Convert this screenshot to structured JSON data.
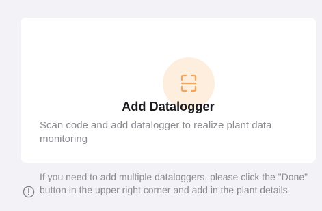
{
  "add_card": {
    "title": "Add Datalogger",
    "description": "Scan code and add datalogger to realize plant data monitoring",
    "icon": "scan-icon",
    "accent_color": "#f5a55b",
    "icon_bg_color": "#fdeede"
  },
  "hint": {
    "icon": "info-circle-icon",
    "text": "If you need to add multiple dataloggers, please click the \"Done\" button in the upper right corner and add in the plant details"
  }
}
